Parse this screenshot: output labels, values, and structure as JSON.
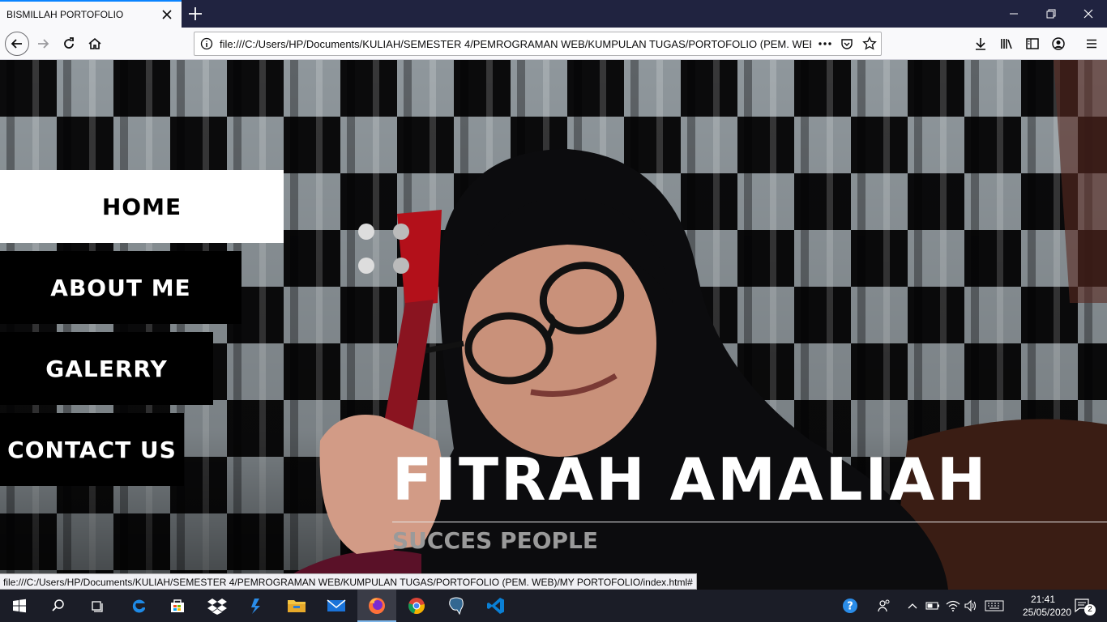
{
  "browser": {
    "tab_title": "BISMILLAH PORTOFOLIO",
    "url": "file:///C:/Users/HP/Documents/KULIAH/SEMESTER 4/PEMROGRAMAN WEB/KUMPULAN TUGAS/PORTOFOLIO (PEM. WEB)/MY PORTOFOLIO/index.html",
    "status_url": "file:///C:/Users/HP/Documents/KULIAH/SEMESTER 4/PEMROGRAMAN WEB/KUMPULAN TUGAS/PORTOFOLIO (PEM. WEB)/MY PORTOFOLIO/index.html#",
    "toolbar_icons": [
      "back-icon",
      "forward-icon",
      "reload-icon",
      "home-icon",
      "info-icon",
      "more-icon",
      "pocket-icon",
      "bookmark-star-icon",
      "download-icon",
      "library-icon",
      "sidebar-icon",
      "account-icon",
      "menu-icon"
    ]
  },
  "site": {
    "menu": [
      {
        "label": "HOME",
        "active": true
      },
      {
        "label": "ABOUT ME",
        "active": false
      },
      {
        "label": "GALERRY",
        "active": false
      },
      {
        "label": "CONTACT US",
        "active": false
      }
    ],
    "hero_name": "FITRAH AMALIAH",
    "hero_subtitle": "SUCCES PEOPLE"
  },
  "taskbar": {
    "apps": [
      "start-icon",
      "search-icon",
      "task-view-icon",
      "edge-icon",
      "store-icon",
      "dropbox-icon",
      "visual-studio-icon",
      "file-explorer-icon",
      "mail-icon",
      "firefox-icon",
      "chrome-icon",
      "postgresql-icon",
      "vscode-icon"
    ],
    "active_app": "firefox-icon",
    "time": "21:41",
    "date": "25/05/2020",
    "notification_count": "2"
  },
  "colors": {
    "accent": "#0a84ff",
    "menu_active_bg": "#ffffff",
    "menu_bg": "#000000",
    "hero_text": "#ffffff",
    "hero_subtitle": "#9a9a9a"
  }
}
